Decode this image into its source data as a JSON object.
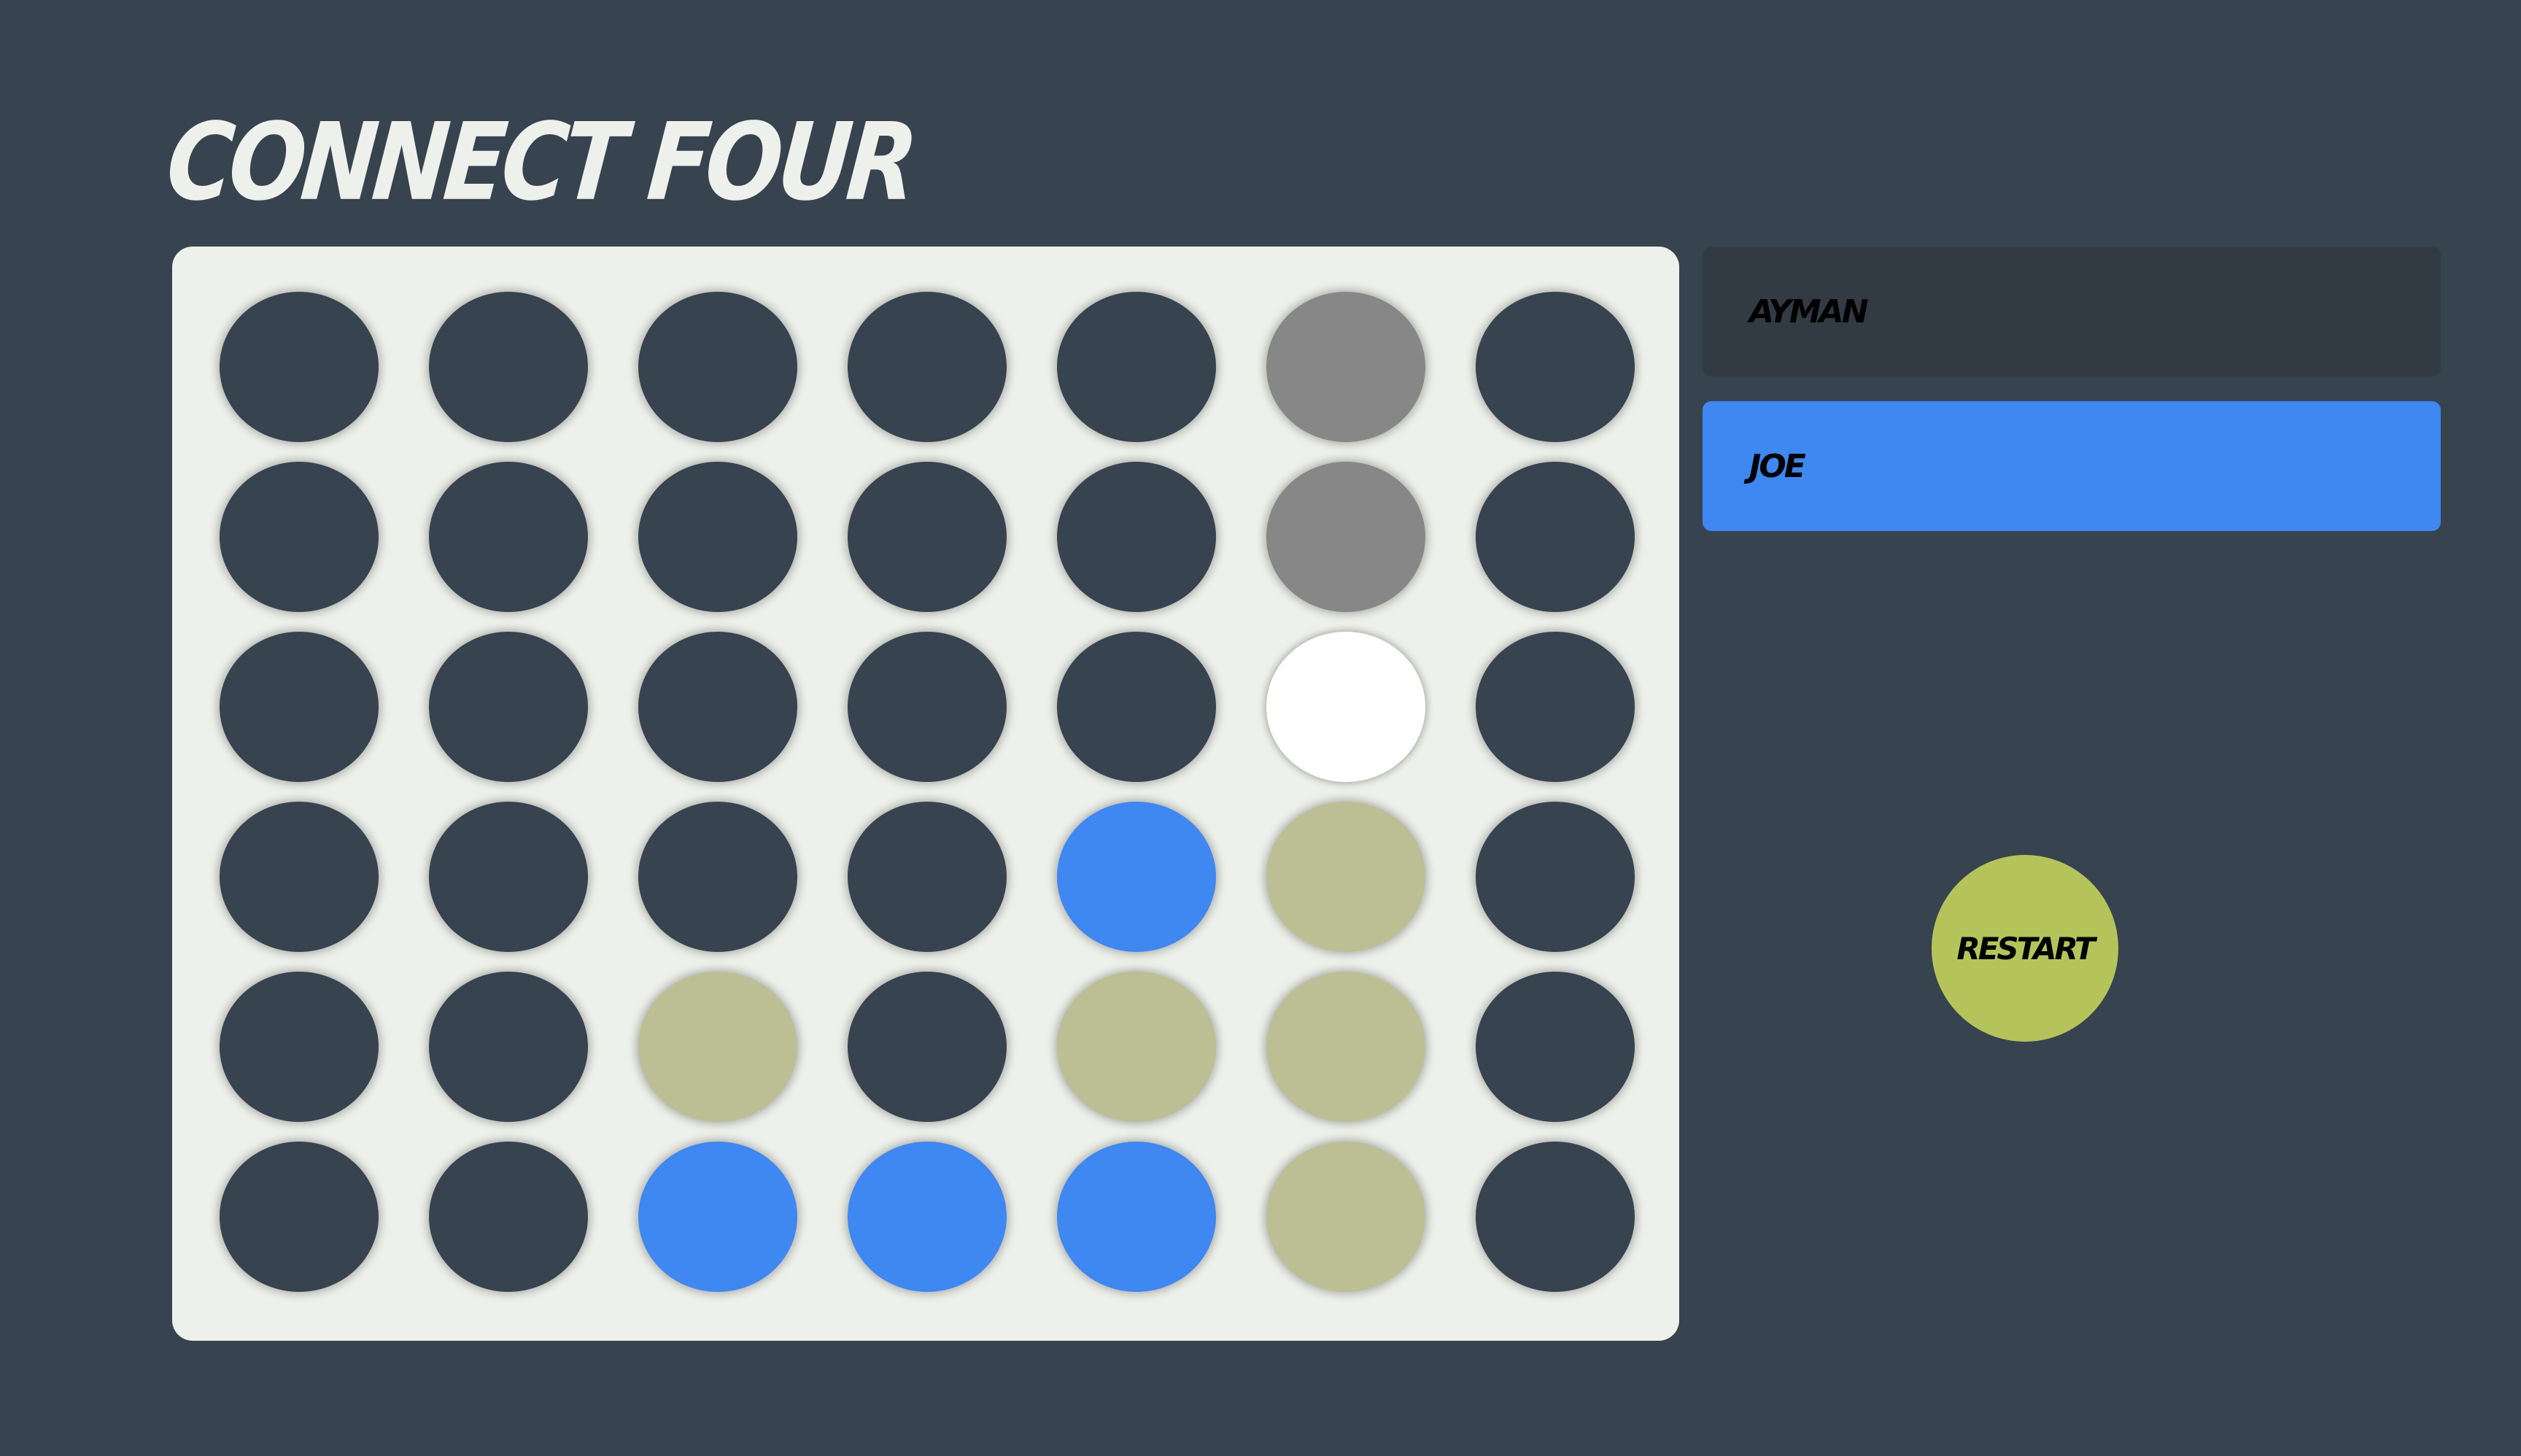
{
  "title": "CONNECT FOUR",
  "players": [
    {
      "name": "AYMAN",
      "active": false
    },
    {
      "name": "JOE",
      "active": true
    }
  ],
  "restart_label": "RESTART",
  "colors": {
    "background": "#37434f",
    "board": "#eef0eb",
    "empty": "#37434f",
    "blue": "#3f87f1",
    "khaki": "#bcbf94",
    "gray": "#878787",
    "white": "#ffffff",
    "restart": "#b4c45a",
    "inactive_player": "#323b44",
    "active_player": "#3f87f1"
  },
  "board": {
    "columns": 7,
    "rows": 6,
    "cells": [
      [
        "empty",
        "empty",
        "empty",
        "empty",
        "empty",
        "gray",
        "empty"
      ],
      [
        "empty",
        "empty",
        "empty",
        "empty",
        "empty",
        "gray",
        "empty"
      ],
      [
        "empty",
        "empty",
        "empty",
        "empty",
        "empty",
        "white",
        "empty"
      ],
      [
        "empty",
        "empty",
        "empty",
        "empty",
        "blue",
        "khaki",
        "empty"
      ],
      [
        "empty",
        "empty",
        "khaki",
        "empty",
        "khaki",
        "khaki",
        "empty"
      ],
      [
        "empty",
        "empty",
        "blue",
        "blue",
        "blue",
        "khaki",
        "empty"
      ]
    ]
  }
}
